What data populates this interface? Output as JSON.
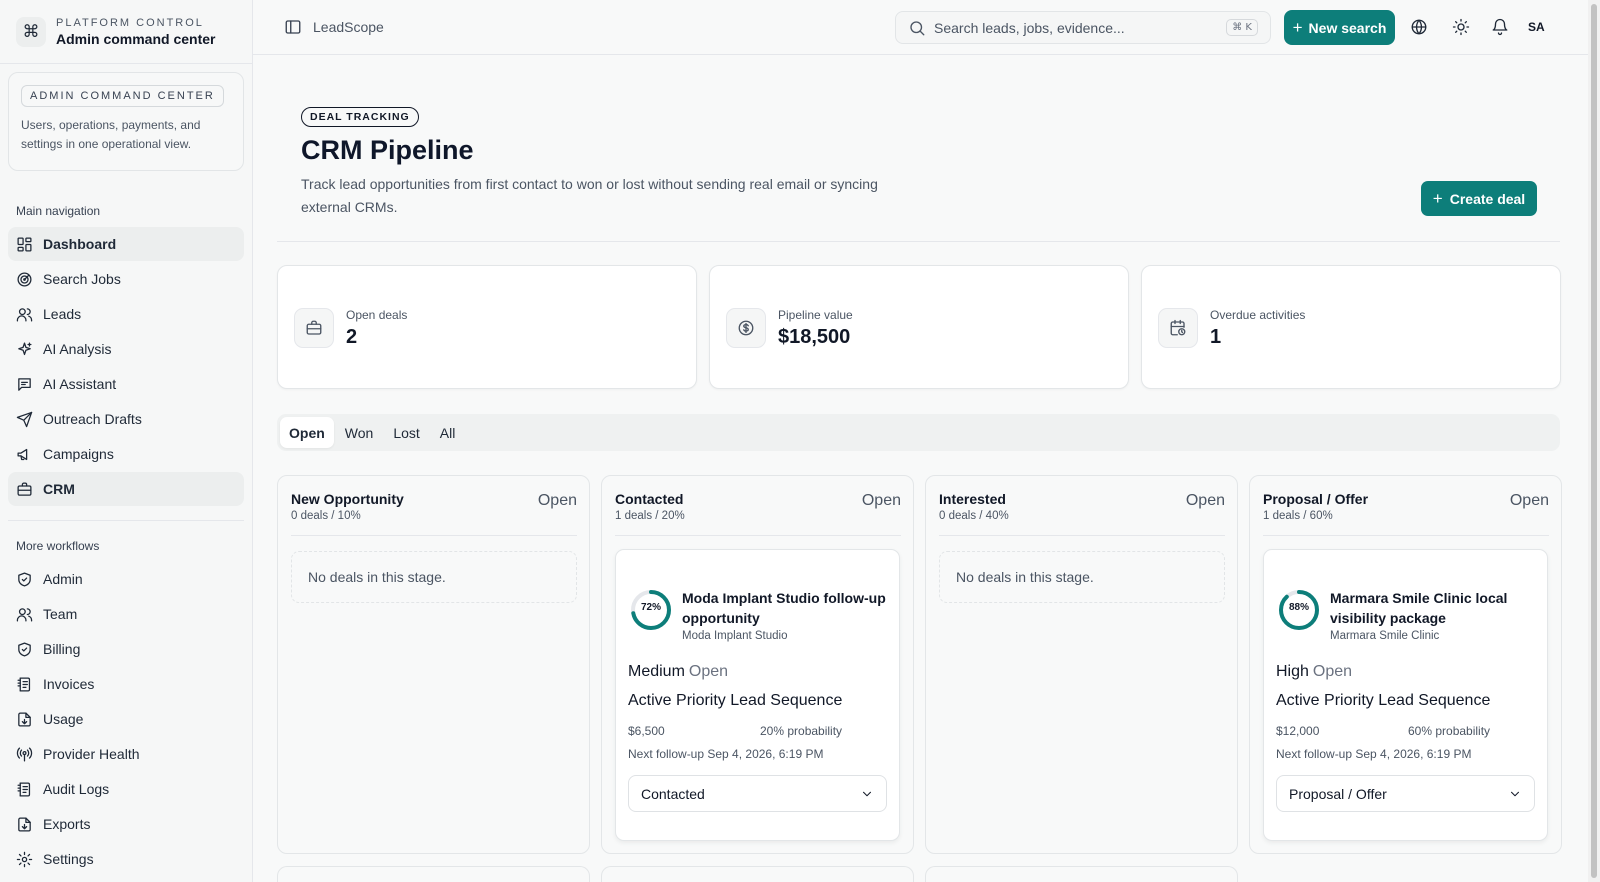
{
  "brand": {
    "kicker": "PLATFORM CONTROL",
    "title": "Admin command center"
  },
  "admin_card": {
    "chip": "ADMIN COMMAND CENTER",
    "description": "Users, operations, payments, and settings in one operational view."
  },
  "nav": {
    "main_heading": "Main navigation",
    "main_items": [
      {
        "label": "Dashboard",
        "icon": "dashboard-icon"
      },
      {
        "label": "Search Jobs",
        "icon": "radar-icon"
      },
      {
        "label": "Leads",
        "icon": "users-icon"
      },
      {
        "label": "AI Analysis",
        "icon": "sparkles-icon"
      },
      {
        "label": "AI Assistant",
        "icon": "chat-icon"
      },
      {
        "label": "Outreach Drafts",
        "icon": "send-icon"
      },
      {
        "label": "Campaigns",
        "icon": "megaphone-icon"
      },
      {
        "label": "CRM",
        "icon": "briefcase-icon"
      }
    ],
    "more_heading": "More workflows",
    "more_items": [
      {
        "label": "Admin",
        "icon": "shield-check-icon"
      },
      {
        "label": "Team",
        "icon": "users-icon"
      },
      {
        "label": "Billing",
        "icon": "shield-icon"
      },
      {
        "label": "Invoices",
        "icon": "receipt-icon"
      },
      {
        "label": "Usage",
        "icon": "file-download-icon"
      },
      {
        "label": "Provider Health",
        "icon": "broadcast-icon"
      },
      {
        "label": "Audit Logs",
        "icon": "receipt-icon"
      },
      {
        "label": "Exports",
        "icon": "file-download-icon"
      },
      {
        "label": "Settings",
        "icon": "gear-icon"
      }
    ]
  },
  "topbar": {
    "app_name": "LeadScope",
    "search_placeholder": "Search leads, jobs, evidence...",
    "search_shortcut": "⌘ K",
    "new_search_label": "New search",
    "avatar_initials": "SA"
  },
  "page": {
    "badge": "DEAL TRACKING",
    "title": "CRM Pipeline",
    "description": "Track lead opportunities from first contact to won or lost without sending real email or syncing external CRMs.",
    "create_label": "Create deal"
  },
  "stats": [
    {
      "label": "Open deals",
      "value": "2",
      "icon": "briefcase-icon"
    },
    {
      "label": "Pipeline value",
      "value": "$18,500",
      "icon": "dollar-circle-icon"
    },
    {
      "label": "Overdue activities",
      "value": "1",
      "icon": "calendar-clock-icon"
    }
  ],
  "filters": [
    "Open",
    "Won",
    "Lost",
    "All"
  ],
  "active_filter": "Open",
  "columns": [
    {
      "name": "New Opportunity",
      "meta": "0 deals / 10%",
      "status": "Open",
      "empty_text": "No deals in this stage."
    },
    {
      "name": "Contacted",
      "meta": "1 deals / 20%",
      "status": "Open",
      "deal": {
        "score": "72%",
        "score_value": 72,
        "title": "Moda Implant Studio follow-up opportunity",
        "company": "Moda Implant Studio",
        "priority": "Medium",
        "state": "Open",
        "sequence": "Active Priority Lead Sequence",
        "value": "$6,500",
        "probability": "20% probability",
        "follow_up": "Next follow-up Sep 4, 2026, 6:19 PM",
        "stage": "Contacted"
      }
    },
    {
      "name": "Interested",
      "meta": "0 deals / 40%",
      "status": "Open",
      "empty_text": "No deals in this stage."
    },
    {
      "name": "Proposal / Offer",
      "meta": "1 deals / 60%",
      "status": "Open",
      "deal": {
        "score": "88%",
        "score_value": 88,
        "title": "Marmara Smile Clinic local visibility package",
        "company": "Marmara Smile Clinic",
        "priority": "High",
        "state": "Open",
        "sequence": "Active Priority Lead Sequence",
        "value": "$12,000",
        "probability": "60% probability",
        "follow_up": "Next follow-up Sep 4, 2026, 6:19 PM",
        "stage": "Proposal / Offer"
      }
    }
  ],
  "colors": {
    "accent": "#0d7e7a",
    "ring": "#0d7e7a",
    "ring_track": "#e5e7eb"
  }
}
